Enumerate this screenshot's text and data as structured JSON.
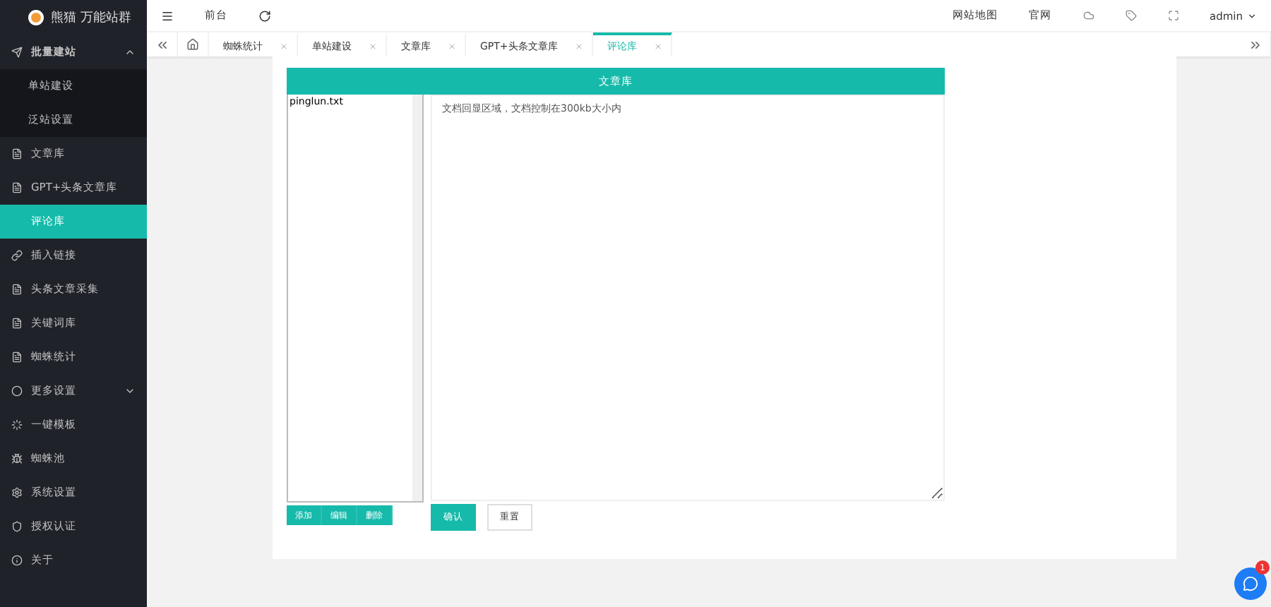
{
  "brand": {
    "name": "熊猫 万能站群"
  },
  "sidebar": {
    "items": [
      {
        "label": "批量建站",
        "expanded": true,
        "selected": false,
        "children": [
          {
            "label": "单站建设",
            "selected": false
          },
          {
            "label": "泛站设置",
            "selected": false
          }
        ]
      },
      {
        "label": "文章库",
        "selected": false
      },
      {
        "label": "GPT+头条文章库",
        "selected": false
      },
      {
        "label": "评论库",
        "selected": true
      },
      {
        "label": "插入链接",
        "selected": false
      },
      {
        "label": "头条文章采集",
        "selected": false
      },
      {
        "label": "关键词库",
        "selected": false
      },
      {
        "label": "蜘蛛统计",
        "selected": false
      },
      {
        "label": "更多设置",
        "expanded": false,
        "selected": false
      },
      {
        "label": "一键模板",
        "selected": false
      },
      {
        "label": "蜘蛛池",
        "selected": false
      },
      {
        "label": "系统设置",
        "selected": false
      },
      {
        "label": "授权认证",
        "selected": false
      },
      {
        "label": "关于",
        "selected": false
      }
    ]
  },
  "header": {
    "left": [
      "前台"
    ],
    "right": [
      "网站地图",
      "官网"
    ],
    "user": "admin"
  },
  "tabs": [
    {
      "label": "蜘蛛统计",
      "selected": false
    },
    {
      "label": "单站建设",
      "selected": false
    },
    {
      "label": "文章库",
      "selected": false
    },
    {
      "label": "GPT+头条文章库",
      "selected": false
    },
    {
      "label": "评论库",
      "selected": true
    }
  ],
  "panel": {
    "title": "文章库",
    "files": [
      {
        "name": "pinglun.txt",
        "selected": false
      }
    ],
    "editor": {
      "placeholder": "文档回显区域，文档控制在300kb大小内"
    },
    "file_buttons": [
      "添加",
      "编辑",
      "删除"
    ],
    "submit": "确认",
    "reset": "重置"
  },
  "chat": {
    "badge": "1"
  }
}
